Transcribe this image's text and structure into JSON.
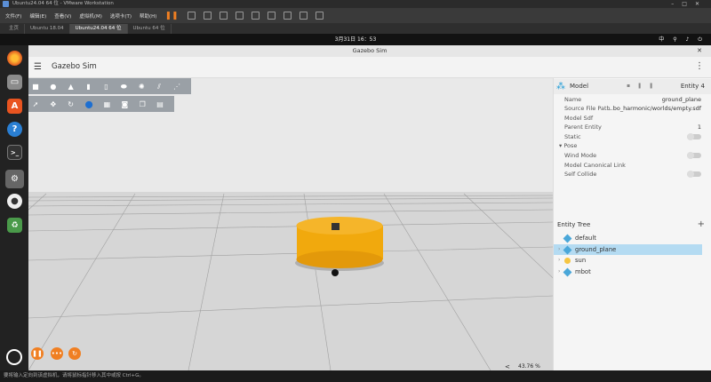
{
  "vmware": {
    "title": "Ubuntu24.04 64 位 - VMware Workstation",
    "menu": [
      "文件(F)",
      "编辑(E)",
      "查看(V)",
      "虚拟机(M)",
      "选项卡(T)",
      "帮助(H)"
    ],
    "tabs": [
      "主页",
      "Ubuntu 18.04",
      "Ubuntu24.04 64 位",
      "Ubuntu 64 位"
    ],
    "active_tab_index": 2,
    "statusbar": "要将输入定向到该虚拟机，请将鼠标指针移入其中或按 Ctrl+G。"
  },
  "ubuntu": {
    "clock": "3月31日  16：53",
    "tray": "中"
  },
  "dock": {
    "items": [
      "firefox-icon",
      "files-icon",
      "app-center-icon",
      "help-icon",
      "terminal-icon",
      "settings-icon",
      "disc-icon",
      "trash-icon"
    ]
  },
  "gazebo": {
    "window_title": "Gazebo Sim",
    "app_name": "Gazebo Sim",
    "stats": {
      "zoom": "<",
      "rtf": "43.76 %"
    },
    "component_inspector": {
      "title": "Model",
      "entity": "Entity 4",
      "properties": [
        {
          "label": "Name",
          "value": "ground_plane"
        },
        {
          "label": "Source File Path",
          "value": "...bo_harmonic/worlds/empty.sdf"
        },
        {
          "label": "Model Sdf",
          "value": ""
        },
        {
          "label": "Parent Entity",
          "value": "1"
        },
        {
          "label": "Static",
          "toggle": true
        },
        {
          "label": "▾ Pose",
          "value": ""
        },
        {
          "label": "Wind Mode",
          "toggle": true
        },
        {
          "label": "Model Canonical Link",
          "value": ""
        },
        {
          "label": "Self Collide",
          "toggle": true
        }
      ]
    },
    "entity_tree": {
      "title": "Entity Tree",
      "add": "+",
      "items": [
        {
          "label": "default",
          "arrow": "",
          "selected": false
        },
        {
          "label": "ground_plane",
          "arrow": "›",
          "selected": true
        },
        {
          "label": "sun",
          "arrow": "›",
          "selected": false
        },
        {
          "label": "mbot",
          "arrow": "›",
          "selected": false
        }
      ]
    }
  },
  "colors": {
    "accent_orange": "#f07f22",
    "selection_blue": "#b4dbf2",
    "entity_cube": "#4aa7d9",
    "robot_body": "#f1a90d"
  }
}
